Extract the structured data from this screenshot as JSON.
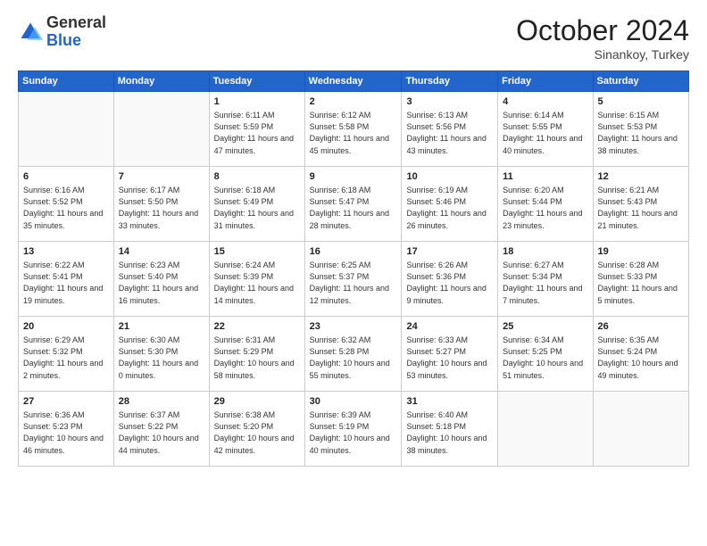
{
  "logo": {
    "general": "General",
    "blue": "Blue"
  },
  "header": {
    "month": "October 2024",
    "location": "Sinankoy, Turkey"
  },
  "weekdays": [
    "Sunday",
    "Monday",
    "Tuesday",
    "Wednesday",
    "Thursday",
    "Friday",
    "Saturday"
  ],
  "weeks": [
    [
      {
        "day": "",
        "info": ""
      },
      {
        "day": "",
        "info": ""
      },
      {
        "day": "1",
        "info": "Sunrise: 6:11 AM\nSunset: 5:59 PM\nDaylight: 11 hours and 47 minutes."
      },
      {
        "day": "2",
        "info": "Sunrise: 6:12 AM\nSunset: 5:58 PM\nDaylight: 11 hours and 45 minutes."
      },
      {
        "day": "3",
        "info": "Sunrise: 6:13 AM\nSunset: 5:56 PM\nDaylight: 11 hours and 43 minutes."
      },
      {
        "day": "4",
        "info": "Sunrise: 6:14 AM\nSunset: 5:55 PM\nDaylight: 11 hours and 40 minutes."
      },
      {
        "day": "5",
        "info": "Sunrise: 6:15 AM\nSunset: 5:53 PM\nDaylight: 11 hours and 38 minutes."
      }
    ],
    [
      {
        "day": "6",
        "info": "Sunrise: 6:16 AM\nSunset: 5:52 PM\nDaylight: 11 hours and 35 minutes."
      },
      {
        "day": "7",
        "info": "Sunrise: 6:17 AM\nSunset: 5:50 PM\nDaylight: 11 hours and 33 minutes."
      },
      {
        "day": "8",
        "info": "Sunrise: 6:18 AM\nSunset: 5:49 PM\nDaylight: 11 hours and 31 minutes."
      },
      {
        "day": "9",
        "info": "Sunrise: 6:18 AM\nSunset: 5:47 PM\nDaylight: 11 hours and 28 minutes."
      },
      {
        "day": "10",
        "info": "Sunrise: 6:19 AM\nSunset: 5:46 PM\nDaylight: 11 hours and 26 minutes."
      },
      {
        "day": "11",
        "info": "Sunrise: 6:20 AM\nSunset: 5:44 PM\nDaylight: 11 hours and 23 minutes."
      },
      {
        "day": "12",
        "info": "Sunrise: 6:21 AM\nSunset: 5:43 PM\nDaylight: 11 hours and 21 minutes."
      }
    ],
    [
      {
        "day": "13",
        "info": "Sunrise: 6:22 AM\nSunset: 5:41 PM\nDaylight: 11 hours and 19 minutes."
      },
      {
        "day": "14",
        "info": "Sunrise: 6:23 AM\nSunset: 5:40 PM\nDaylight: 11 hours and 16 minutes."
      },
      {
        "day": "15",
        "info": "Sunrise: 6:24 AM\nSunset: 5:39 PM\nDaylight: 11 hours and 14 minutes."
      },
      {
        "day": "16",
        "info": "Sunrise: 6:25 AM\nSunset: 5:37 PM\nDaylight: 11 hours and 12 minutes."
      },
      {
        "day": "17",
        "info": "Sunrise: 6:26 AM\nSunset: 5:36 PM\nDaylight: 11 hours and 9 minutes."
      },
      {
        "day": "18",
        "info": "Sunrise: 6:27 AM\nSunset: 5:34 PM\nDaylight: 11 hours and 7 minutes."
      },
      {
        "day": "19",
        "info": "Sunrise: 6:28 AM\nSunset: 5:33 PM\nDaylight: 11 hours and 5 minutes."
      }
    ],
    [
      {
        "day": "20",
        "info": "Sunrise: 6:29 AM\nSunset: 5:32 PM\nDaylight: 11 hours and 2 minutes."
      },
      {
        "day": "21",
        "info": "Sunrise: 6:30 AM\nSunset: 5:30 PM\nDaylight: 11 hours and 0 minutes."
      },
      {
        "day": "22",
        "info": "Sunrise: 6:31 AM\nSunset: 5:29 PM\nDaylight: 10 hours and 58 minutes."
      },
      {
        "day": "23",
        "info": "Sunrise: 6:32 AM\nSunset: 5:28 PM\nDaylight: 10 hours and 55 minutes."
      },
      {
        "day": "24",
        "info": "Sunrise: 6:33 AM\nSunset: 5:27 PM\nDaylight: 10 hours and 53 minutes."
      },
      {
        "day": "25",
        "info": "Sunrise: 6:34 AM\nSunset: 5:25 PM\nDaylight: 10 hours and 51 minutes."
      },
      {
        "day": "26",
        "info": "Sunrise: 6:35 AM\nSunset: 5:24 PM\nDaylight: 10 hours and 49 minutes."
      }
    ],
    [
      {
        "day": "27",
        "info": "Sunrise: 6:36 AM\nSunset: 5:23 PM\nDaylight: 10 hours and 46 minutes."
      },
      {
        "day": "28",
        "info": "Sunrise: 6:37 AM\nSunset: 5:22 PM\nDaylight: 10 hours and 44 minutes."
      },
      {
        "day": "29",
        "info": "Sunrise: 6:38 AM\nSunset: 5:20 PM\nDaylight: 10 hours and 42 minutes."
      },
      {
        "day": "30",
        "info": "Sunrise: 6:39 AM\nSunset: 5:19 PM\nDaylight: 10 hours and 40 minutes."
      },
      {
        "day": "31",
        "info": "Sunrise: 6:40 AM\nSunset: 5:18 PM\nDaylight: 10 hours and 38 minutes."
      },
      {
        "day": "",
        "info": ""
      },
      {
        "day": "",
        "info": ""
      }
    ]
  ]
}
